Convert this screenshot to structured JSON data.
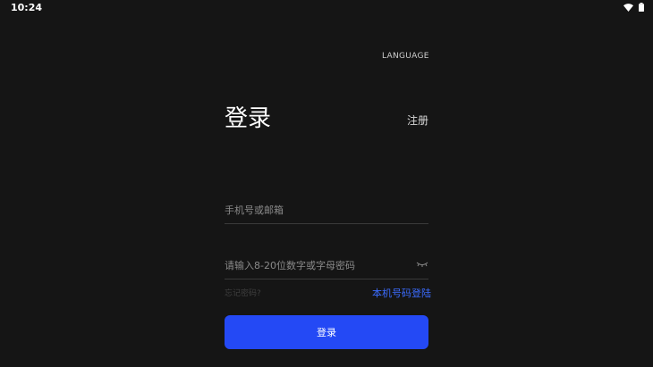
{
  "status_bar": {
    "time": "10:24",
    "icons": [
      "wifi-icon",
      "battery-icon"
    ]
  },
  "header": {
    "language_label": "LANGUAGE"
  },
  "login": {
    "title": "登录",
    "register_label": "注册",
    "account": {
      "value": "",
      "placeholder": "手机号或邮箱"
    },
    "password": {
      "value": "",
      "placeholder": "请输入8-20位数字或字母密码",
      "toggle_icon": "eye-closed-icon"
    },
    "forgot_label": "忘记密码?",
    "local_login_label": "本机号码登陆",
    "submit_label": "登录"
  },
  "colors": {
    "background": "#151515",
    "accent": "#2449f5",
    "link": "#3b6cff"
  }
}
